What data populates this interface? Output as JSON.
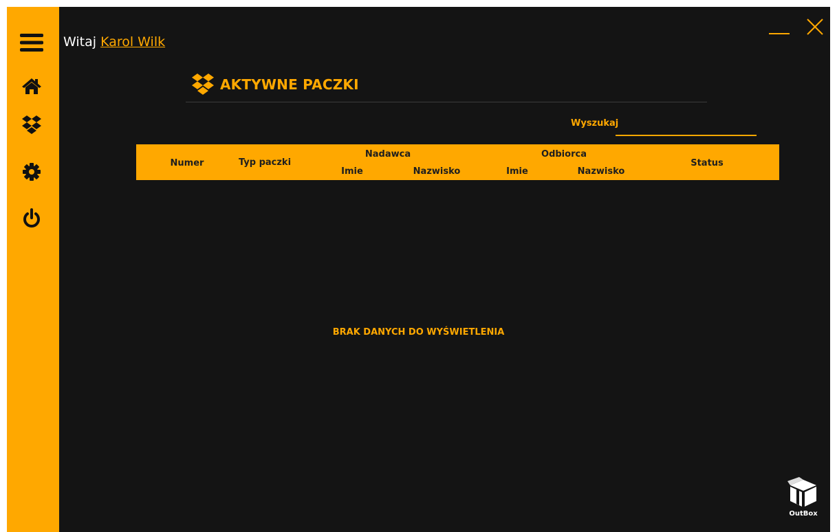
{
  "header": {
    "greeting": "Witaj",
    "user_name": "Karol Wilk"
  },
  "sidebar": {
    "items": [
      {
        "name": "menu",
        "icon": "hamburger-menu-icon"
      },
      {
        "name": "home",
        "icon": "home-icon"
      },
      {
        "name": "packages",
        "icon": "dropbox-icon"
      },
      {
        "name": "settings",
        "icon": "gear-icon"
      },
      {
        "name": "logout",
        "icon": "power-icon"
      }
    ]
  },
  "window_controls": {
    "minimize_icon": "minimize-icon",
    "close_icon": "close-icon"
  },
  "page": {
    "title": "AKTYWNE PACZKI",
    "title_icon": "dropbox-icon"
  },
  "search": {
    "label": "Wyszukaj",
    "value": ""
  },
  "table": {
    "columns": {
      "numer": "Numer",
      "typ": "Typ paczki",
      "nadawca": "Nadawca",
      "nadawca_imie": "Imie",
      "nadawca_nazwisko": "Nazwisko",
      "odbiorca": "Odbiorca",
      "odbiorca_imie": "Imie",
      "odbiorca_nazwisko": "Nazwisko",
      "status": "Status"
    },
    "rows": [],
    "empty_message": "BRAK DANYCH DO WYŚWIETLENIA"
  },
  "logo": {
    "text": "OutBox",
    "icon": "outbox-box-icon"
  },
  "colors": {
    "accent": "#ffa800",
    "background": "#141414",
    "header_text": "#1e1e1e"
  }
}
